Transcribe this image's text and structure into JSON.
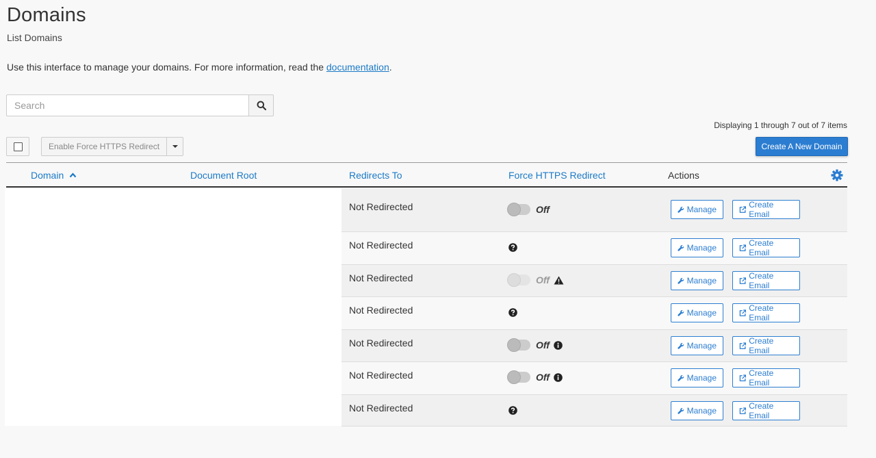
{
  "header": {
    "title": "Domains",
    "subtitle": "List Domains",
    "intro_text": "Use this interface to manage your domains. For more information, read the",
    "intro_link": "documentation",
    "intro_end": "."
  },
  "search": {
    "placeholder": "Search",
    "value": ""
  },
  "pagination": {
    "displaying_text": "Displaying 1 through 7 out of 7 items"
  },
  "toolbar": {
    "bulk_action_label": "Enable Force HTTPS Redirect",
    "create_button_label": "Create A New Domain"
  },
  "table": {
    "columns": {
      "domain": "Domain",
      "document_root": "Document Root",
      "redirects_to": "Redirects To",
      "force_https": "Force HTTPS Redirect",
      "actions": "Actions"
    },
    "sort": {
      "column": "domain",
      "direction": "ascending"
    },
    "manage_label": "Manage",
    "create_email_label": "Create Email",
    "off_label": "Off",
    "rows": [
      {
        "redirects_to": "Not Redirected",
        "https_state": "toggle",
        "https_label": "Off",
        "status_icon": "none"
      },
      {
        "redirects_to": "Not Redirected",
        "https_state": "question",
        "https_label": "",
        "status_icon": "question-icon"
      },
      {
        "redirects_to": "Not Redirected",
        "https_state": "toggle-disabled",
        "https_label": "Off",
        "status_icon": "warning-icon"
      },
      {
        "redirects_to": "Not Redirected",
        "https_state": "question",
        "https_label": "",
        "status_icon": "question-icon"
      },
      {
        "redirects_to": "Not Redirected",
        "https_state": "toggle",
        "https_label": "Off",
        "status_icon": "info-icon"
      },
      {
        "redirects_to": "Not Redirected",
        "https_state": "toggle",
        "https_label": "Off",
        "status_icon": "info-icon"
      },
      {
        "redirects_to": "Not Redirected",
        "https_state": "question",
        "https_label": "",
        "status_icon": "question-icon"
      }
    ]
  },
  "colors": {
    "accent": "#2b7dd1",
    "link": "#1b7ac7",
    "background": "#f8f8f8"
  }
}
